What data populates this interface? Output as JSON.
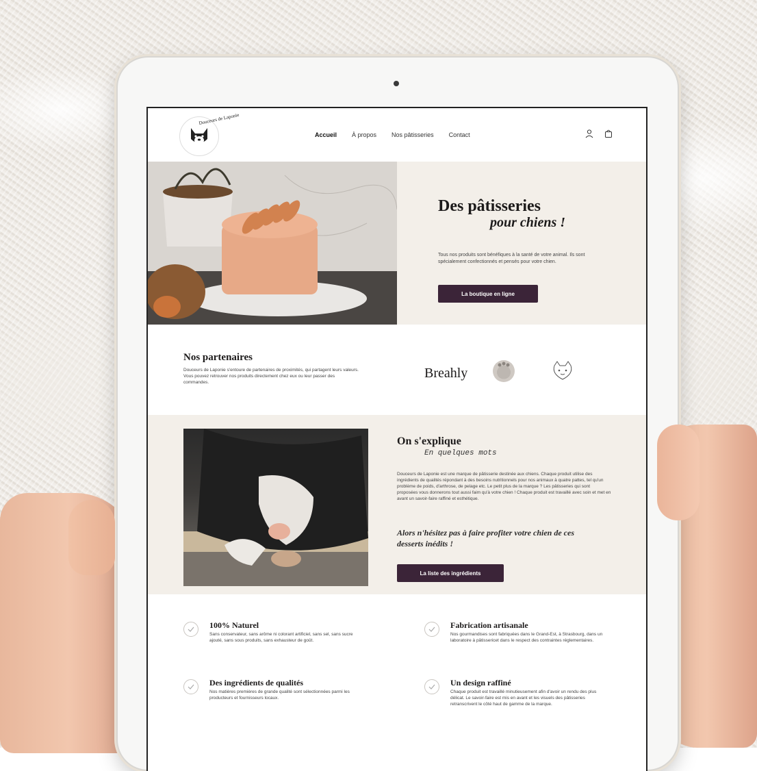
{
  "header": {
    "logo_text": "Douceurs de Laponie",
    "nav": [
      "Accueil",
      "À propos",
      "Nos pâtisseries",
      "Contact"
    ],
    "active_index": 0
  },
  "hero": {
    "title": "Des pâtisseries",
    "subtitle": "pour chiens !",
    "text": "Tous nos produits sont bénéfiques à la santé de votre animal. Ils sont spécialement confectionnés et pensés pour votre chien.",
    "button_label": "La boutique en ligne"
  },
  "partners": {
    "title": "Nos partenaires",
    "text": "Douceurs de Laponie s'entoure de partenaires de proximités, qui partagent leurs valeurs. Vous pouvez retrouver nos produits directement chez eux ou leur passer des commandes.",
    "brand_breahly": "Breahly"
  },
  "explain": {
    "title": "On s'explique",
    "subtitle": "En quelques mots",
    "text": "Douceurs de Laponie est une marque de pâtisserie destinée aux chiens. Chaque produit utilise des ingrédients de qualités répondant à des besoins nutritionnels pour nos animaux à quatre pattes, tel qu'un problème de poids, d'arthrose, de pelage etc. Le petit plus de la marque ? Les pâtisseries qui sont proposées vous donnerons tout aussi faim qu'à votre chien ! Chaque produit est travaillé avec soin et met en avant un savoir-faire raffiné et esthétique.",
    "quote": "Alors n'hésitez pas à faire profiter votre chien de ces desserts inédits !",
    "button_label": "La liste des ingrédients"
  },
  "features": [
    {
      "title": "100% Naturel",
      "text": "Sans conservateur, sans arôme ni colorant artificiel, sans sel, sans sucre ajouté, sans sous produits, sans exhausteur de goût."
    },
    {
      "title": "Fabrication artisanale",
      "text": "Nos gourmandises sont fabriquées dans le Grand-Est, à Strasbourg, dans un laboratoire à pâtissericet dans le respect des contraintes réglementaires."
    },
    {
      "title": "Des ingrédients de qualités",
      "text": "Nos matières premières de grande qualité sont sélectionnées parmi les producteurs et fournisseurs locaux."
    },
    {
      "title": "Un design raffiné",
      "text": "Chaque produit est travaillé minutieusement afin d'avoir un rendu des plus délicat. Le savoir-faire est mis en avant et les visuels des pâtisseries retranscrivent le côté haut de gamme de la marque."
    }
  ],
  "colors": {
    "accent": "#3b2438",
    "cream": "#f3efe9"
  }
}
